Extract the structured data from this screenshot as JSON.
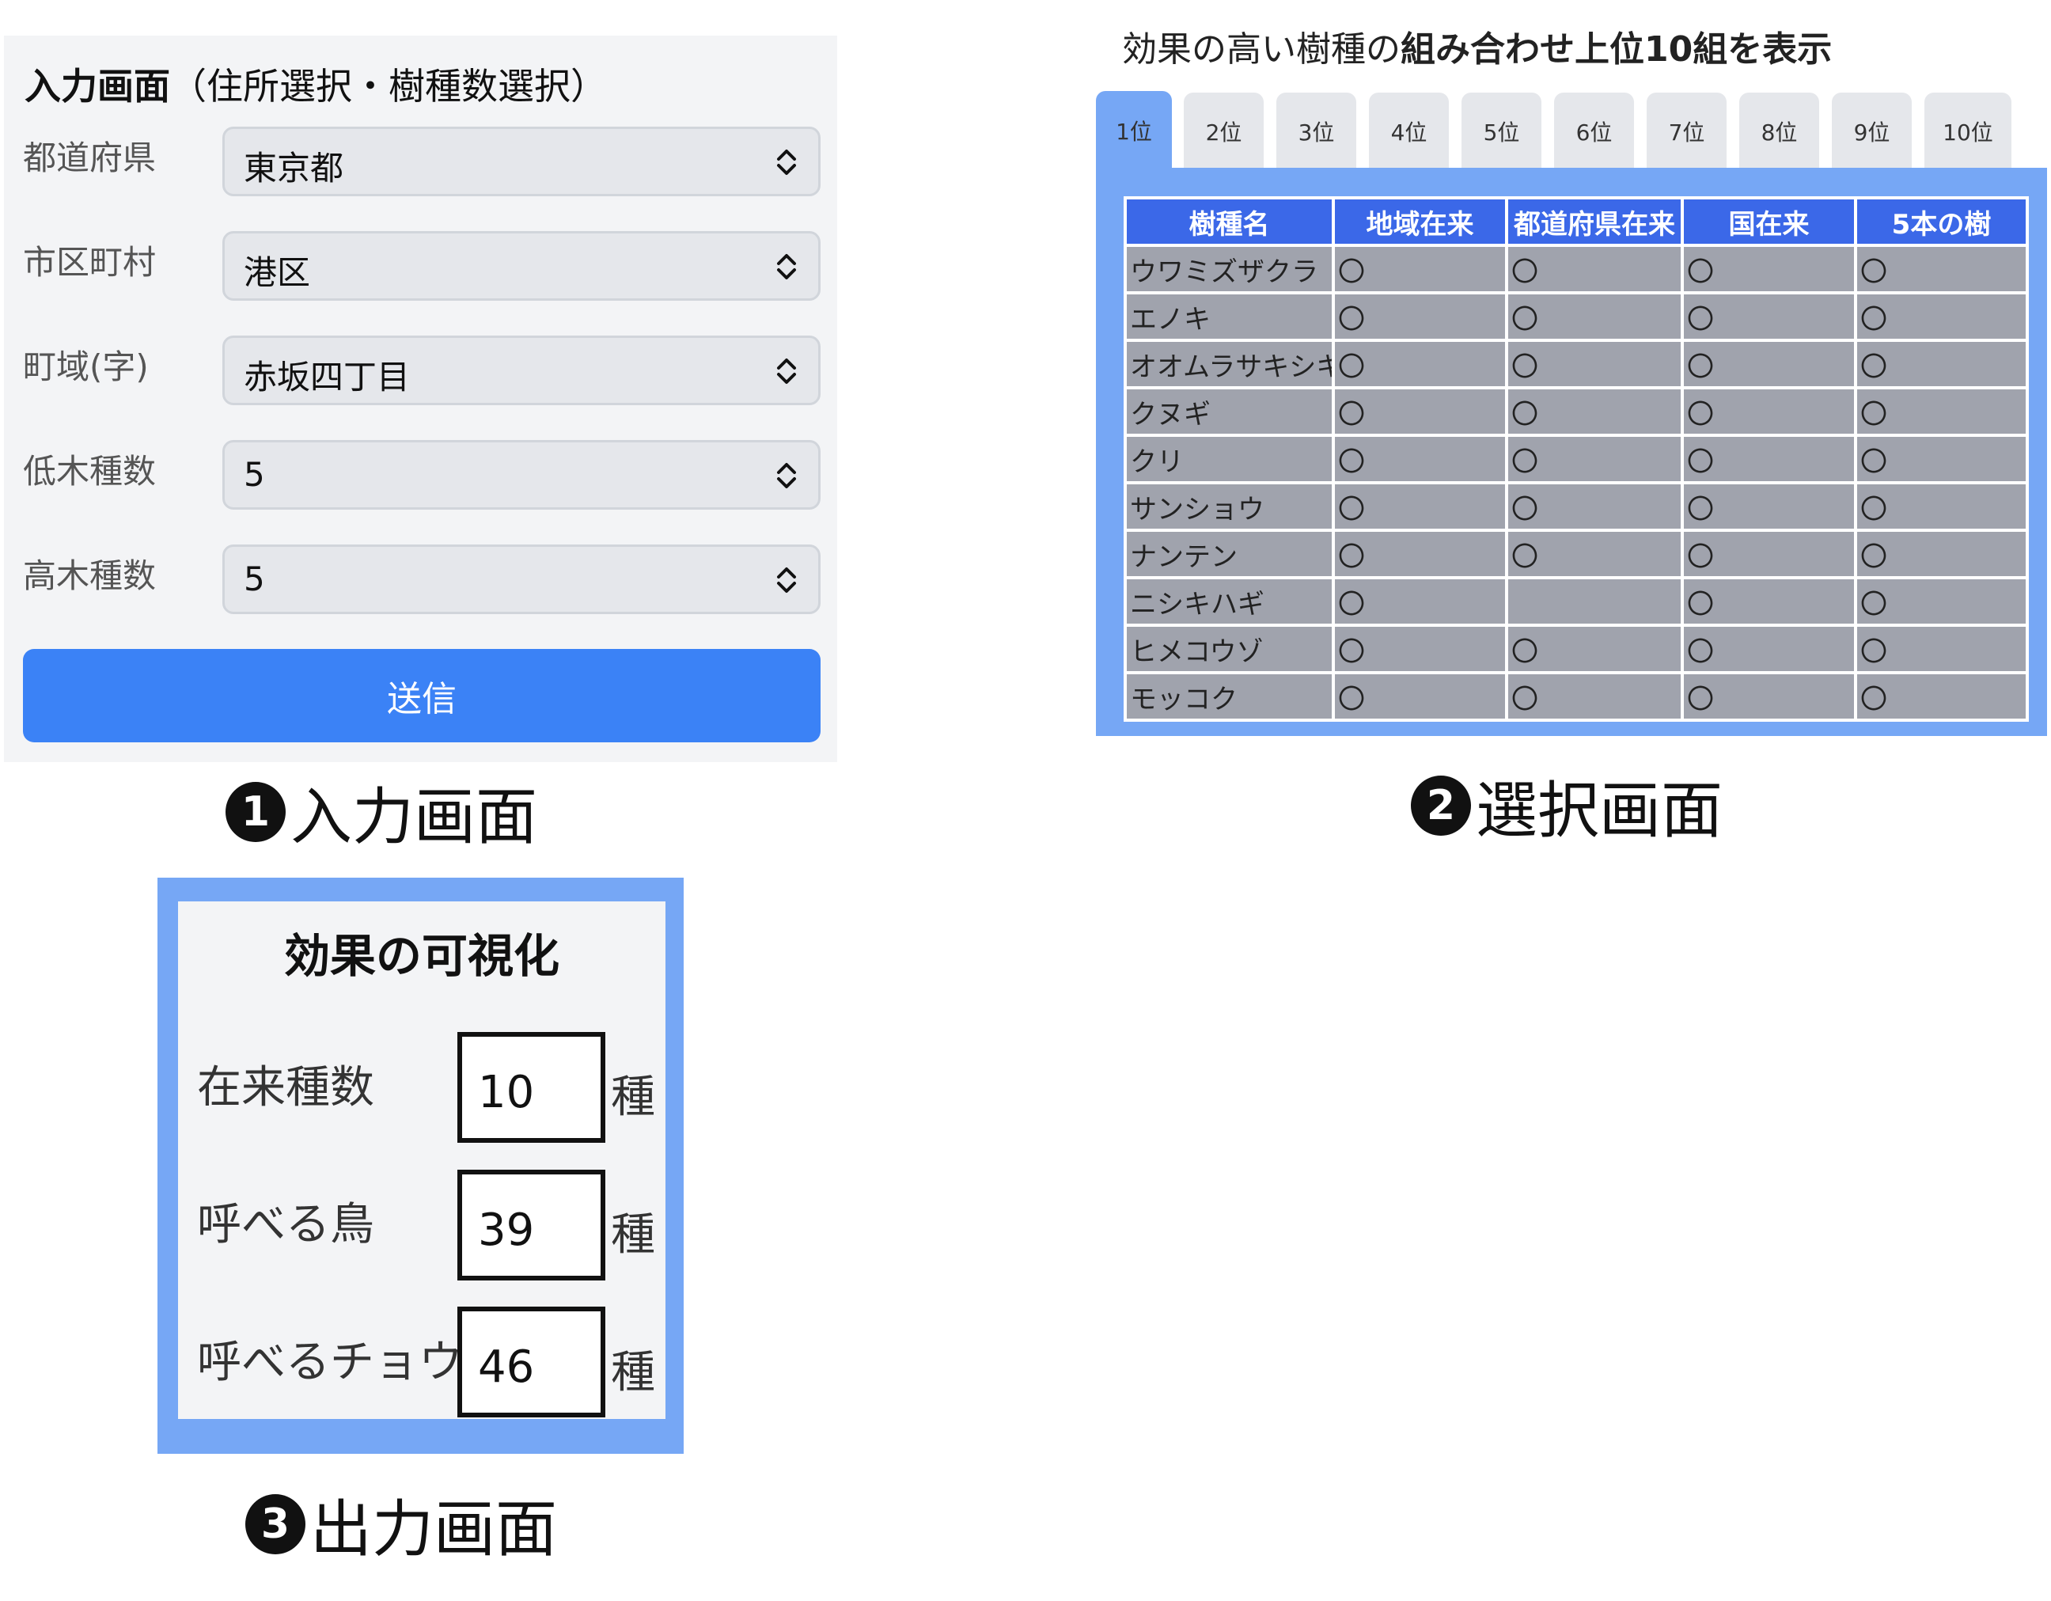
{
  "input_screen": {
    "heading_bold": "入力画面",
    "heading_rest": "（住所選択・樹種数選択）",
    "fields": [
      {
        "label": "都道府県",
        "value": "東京都"
      },
      {
        "label": "市区町村",
        "value": "港区"
      },
      {
        "label": "町域(字)",
        "value": "赤坂四丁目"
      },
      {
        "label": "低木種数",
        "value": "5"
      },
      {
        "label": "高木種数",
        "value": "5"
      }
    ],
    "submit_label": "送信",
    "caption_number": "1",
    "caption": "入力画面"
  },
  "selection_screen": {
    "title_normal": "効果の高い樹種の",
    "title_bold": "組み合わせ上位10組を表示",
    "tabs": [
      "1位",
      "2位",
      "3位",
      "4位",
      "5位",
      "6位",
      "7位",
      "8位",
      "9位",
      "10位"
    ],
    "active_tab": 0,
    "table": {
      "headers": [
        "樹種名",
        "地域在来",
        "都道府県在来",
        "国在来",
        "5本の樹"
      ],
      "rows": [
        {
          "name": "ウワミズザクラ",
          "marks": [
            "〇",
            "〇",
            "〇",
            "〇"
          ]
        },
        {
          "name": "エノキ",
          "marks": [
            "〇",
            "〇",
            "〇",
            "〇"
          ]
        },
        {
          "name": "オオムラサキシキブ",
          "marks": [
            "〇",
            "〇",
            "〇",
            "〇"
          ]
        },
        {
          "name": "クヌギ",
          "marks": [
            "〇",
            "〇",
            "〇",
            "〇"
          ]
        },
        {
          "name": "クリ",
          "marks": [
            "〇",
            "〇",
            "〇",
            "〇"
          ]
        },
        {
          "name": "サンショウ",
          "marks": [
            "〇",
            "〇",
            "〇",
            "〇"
          ]
        },
        {
          "name": "ナンテン",
          "marks": [
            "〇",
            "〇",
            "〇",
            "〇"
          ]
        },
        {
          "name": "ニシキハギ",
          "marks": [
            "〇",
            "",
            "〇",
            "〇"
          ]
        },
        {
          "name": "ヒメコウゾ",
          "marks": [
            "〇",
            "〇",
            "〇",
            "〇"
          ]
        },
        {
          "name": "モッコク",
          "marks": [
            "〇",
            "〇",
            "〇",
            "〇"
          ]
        }
      ]
    },
    "caption_number": "2",
    "caption": "選択画面"
  },
  "output_screen": {
    "title": "効果の可視化",
    "metrics": [
      {
        "label": "在来種数",
        "value": "10",
        "unit": "種"
      },
      {
        "label": "呼べる鳥",
        "value": "39",
        "unit": "種"
      },
      {
        "label": "呼べるチョウ",
        "value": "46",
        "unit": "種"
      }
    ],
    "caption_number": "3",
    "caption": "出力画面"
  },
  "colors": {
    "accent_blue": "#3b82f6",
    "frame_blue": "#76a7f5",
    "table_header": "#3b68e8",
    "table_cell": "#a0a3ad"
  }
}
